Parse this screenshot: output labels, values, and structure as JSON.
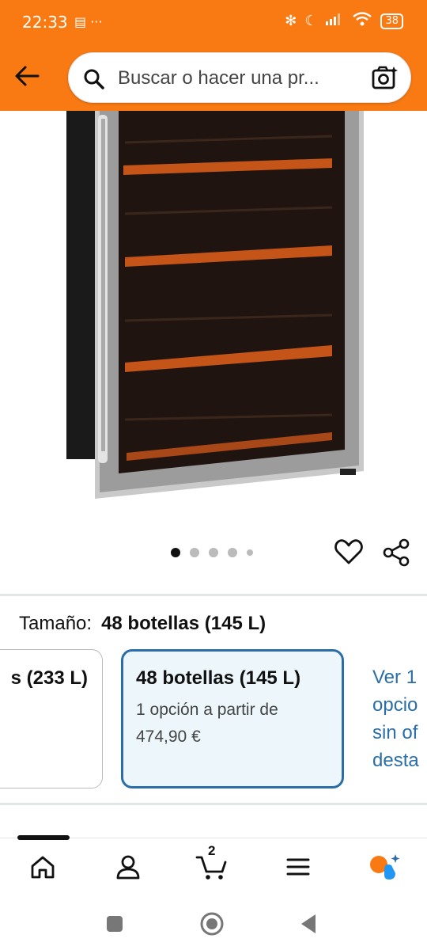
{
  "status_bar": {
    "time": "22:33",
    "left_icons": "▤ ···",
    "right_icons": [
      "bluetooth-icon",
      "moon-icon",
      "signal-icon",
      "wifi-icon"
    ],
    "battery": "38"
  },
  "header": {
    "search_placeholder": "Buscar o hacer una pr...",
    "accent_color": "#f97a12"
  },
  "product": {
    "image_description_icon": "wine-cooler-image",
    "carousel_pages": 5,
    "carousel_active": 1
  },
  "size_selector": {
    "label": "Tamaño:",
    "selected_value": "48 botellas (145 L)",
    "options": [
      {
        "title": "s (233 L)"
      },
      {
        "title": "48 botellas (145 L)",
        "subtitle_1": "1 opción a partir de",
        "subtitle_2": "474,90 €"
      }
    ],
    "more_link_lines": [
      "Ver 1",
      "opcio",
      "sin of",
      "desta"
    ]
  },
  "bottom_nav": {
    "items": [
      "home-icon",
      "account-icon",
      "cart-icon",
      "menu-icon",
      "rufus-icon"
    ],
    "cart_count": "2"
  },
  "system_nav": [
    "recents-button",
    "home-button",
    "back-button"
  ]
}
